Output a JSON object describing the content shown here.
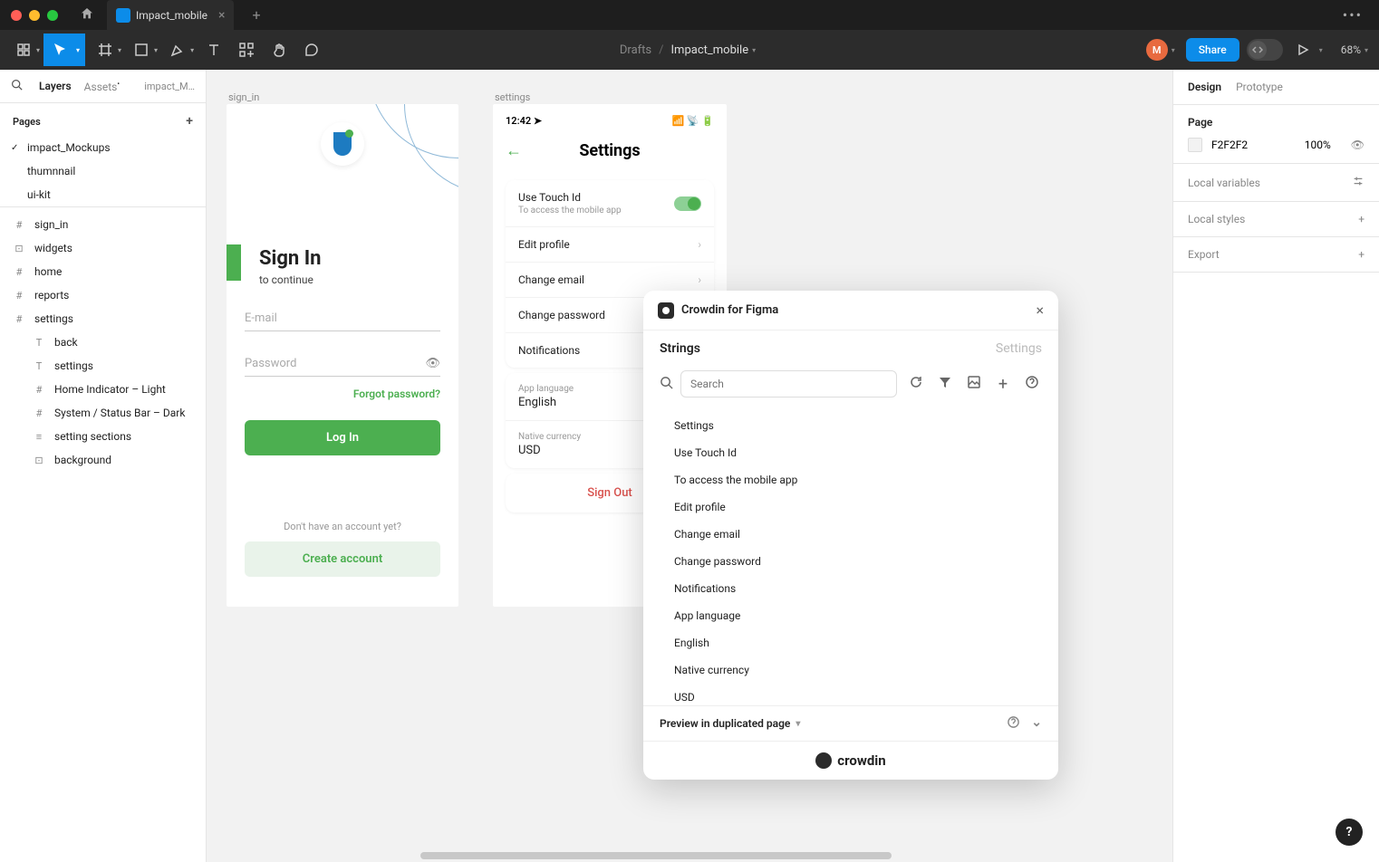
{
  "titlebar": {
    "tab_title": "Impact_mobile"
  },
  "toolbar": {
    "breadcrumb_parent": "Drafts",
    "breadcrumb_sep": "/",
    "breadcrumb_current": "Impact_mobile",
    "avatar_initial": "M",
    "share_label": "Share",
    "zoom": "68%"
  },
  "left_panel": {
    "tabs": {
      "layers": "Layers",
      "assets": "Assets",
      "crumb": "impact_M…"
    },
    "pages_header": "Pages",
    "pages": [
      {
        "name": "impact_Mockups",
        "selected": true
      },
      {
        "name": "thumnnail",
        "selected": false
      },
      {
        "name": "ui-kit",
        "selected": false
      }
    ],
    "layers": [
      {
        "icon": "#",
        "name": "sign_in",
        "sub": false
      },
      {
        "icon": "⊡",
        "name": "widgets",
        "sub": false
      },
      {
        "icon": "#",
        "name": "home",
        "sub": false
      },
      {
        "icon": "#",
        "name": "reports",
        "sub": false
      },
      {
        "icon": "#",
        "name": "settings",
        "sub": false
      },
      {
        "icon": "T",
        "name": "back",
        "sub": true
      },
      {
        "icon": "T",
        "name": "settings",
        "sub": true
      },
      {
        "icon": "#",
        "name": "Home Indicator – Light",
        "sub": true
      },
      {
        "icon": "#",
        "name": "System / Status Bar – Dark",
        "sub": true
      },
      {
        "icon": "≡",
        "name": "setting sections",
        "sub": true
      },
      {
        "icon": "⊡",
        "name": "background",
        "sub": true
      }
    ]
  },
  "canvas": {
    "sign_in": {
      "frame_label": "sign_in",
      "title": "Sign In",
      "subtitle": "to continue",
      "email_placeholder": "E-mail",
      "password_placeholder": "Password",
      "forgot": "Forgot password?",
      "login": "Log In",
      "no_account": "Don't have an account yet?",
      "create": "Create account"
    },
    "settings": {
      "frame_label": "settings",
      "time": "12:42",
      "title": "Settings",
      "touch_id": "Use Touch Id",
      "touch_id_sub": "To access the mobile app",
      "edit_profile": "Edit profile",
      "change_email": "Change email",
      "change_password": "Change password",
      "notifications": "Notifications",
      "app_lang_label": "App language",
      "app_lang_value": "English",
      "currency_label": "Native currency",
      "currency_value": "USD",
      "sign_out": "Sign Out"
    }
  },
  "right_panel": {
    "tabs": {
      "design": "Design",
      "prototype": "Prototype"
    },
    "page_header": "Page",
    "bg_color": "F2F2F2",
    "bg_opacity": "100%",
    "local_variables": "Local variables",
    "local_styles": "Local styles",
    "export": "Export"
  },
  "plugin": {
    "title": "Crowdin for Figma",
    "tabs": {
      "strings": "Strings",
      "settings": "Settings"
    },
    "search_placeholder": "Search",
    "strings": [
      "Settings",
      "Use Touch Id",
      "To access the mobile app",
      "Edit profile",
      "Change email",
      "Change password",
      "Notifications",
      "App language",
      "English",
      "Native currency",
      "USD"
    ],
    "footer": "Preview in duplicated page",
    "brand": "crowdin"
  }
}
